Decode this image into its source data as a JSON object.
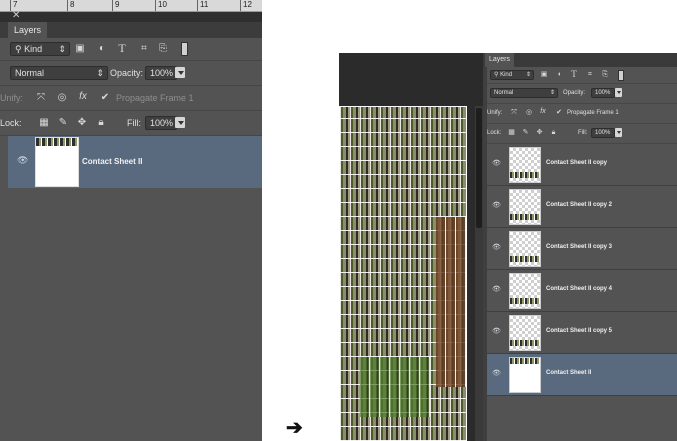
{
  "before": {
    "ruler": [
      "7",
      "8",
      "9",
      "10",
      "11",
      "12"
    ],
    "panel_tab": "Layers",
    "filter": {
      "label": "Kind"
    },
    "blend_mode": "Normal",
    "opacity_label": "Opacity:",
    "opacity_value": "100%",
    "unify_label": "Unify:",
    "propagate_label": "Propagate Frame 1",
    "lock_label": "Lock:",
    "fill_label": "Fill:",
    "fill_value": "100%",
    "layers": [
      {
        "name": "Contact Sheet II",
        "selected": true
      }
    ]
  },
  "arrow": "➔",
  "after": {
    "panel_tab": "Layers",
    "filter": {
      "label": "Kind"
    },
    "blend_mode": "Normal",
    "opacity_label": "Opacity:",
    "opacity_value": "100%",
    "unify_label": "Unify:",
    "propagate_label": "Propagate Frame 1",
    "lock_label": "Lock:",
    "fill_label": "Fill:",
    "fill_value": "100%",
    "layers": [
      {
        "name": "Contact Sheet II copy"
      },
      {
        "name": "Contact Sheet II copy 2"
      },
      {
        "name": "Contact Sheet II copy 3"
      },
      {
        "name": "Contact Sheet II copy 4"
      },
      {
        "name": "Contact Sheet II copy 5"
      },
      {
        "name": "Contact Sheet II",
        "selected": true
      }
    ]
  },
  "colors": {
    "panel": "#535353",
    "selection": "#596a7f",
    "dark": "#2c2c2c"
  }
}
